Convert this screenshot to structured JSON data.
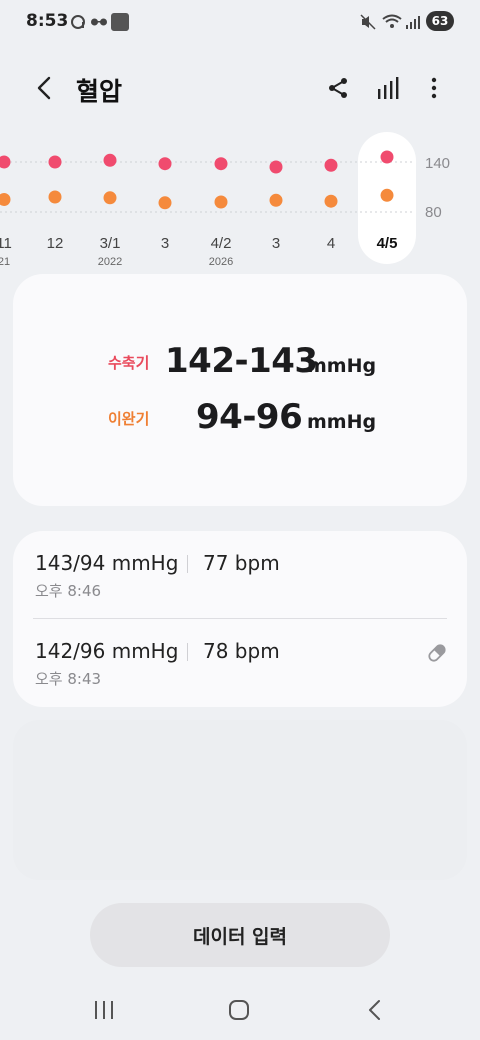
{
  "status_bar": {
    "time": "8:53",
    "battery": "63"
  },
  "header": {
    "title": "혈압"
  },
  "chart_data": {
    "type": "scatter",
    "x_labels": [
      "11",
      "12",
      "3/1",
      "3",
      "4/2",
      "3",
      "4",
      "4/5"
    ],
    "x_sublabels": [
      "21",
      "",
      "2022",
      "",
      "2026",
      "",
      "",
      ""
    ],
    "selected_index": 7,
    "y_ticks": [
      140,
      80
    ],
    "series": [
      {
        "name": "수축기",
        "color": "#f04b6e",
        "values": [
          140,
          140,
          142,
          138,
          138,
          134,
          136,
          146
        ]
      },
      {
        "name": "이완기",
        "color": "#f58a3c",
        "values": [
          95,
          98,
          97,
          91,
          92,
          94,
          93,
          100
        ]
      }
    ]
  },
  "summary": {
    "systolic_label": "수축기",
    "systolic_value": "142-143",
    "diastolic_label": "이완기",
    "diastolic_value": "94-96",
    "unit": "mmHg",
    "systolic_color": "#e94a5c",
    "diastolic_color": "#ef7f33"
  },
  "records": [
    {
      "bp": "143/94 mmHg",
      "bpm": "77 bpm",
      "time": "오후 8:46",
      "has_medication": false
    },
    {
      "bp": "142/96 mmHg",
      "bpm": "78 bpm",
      "time": "오후 8:43",
      "has_medication": true
    }
  ],
  "enter_data_label": "데이터 입력"
}
